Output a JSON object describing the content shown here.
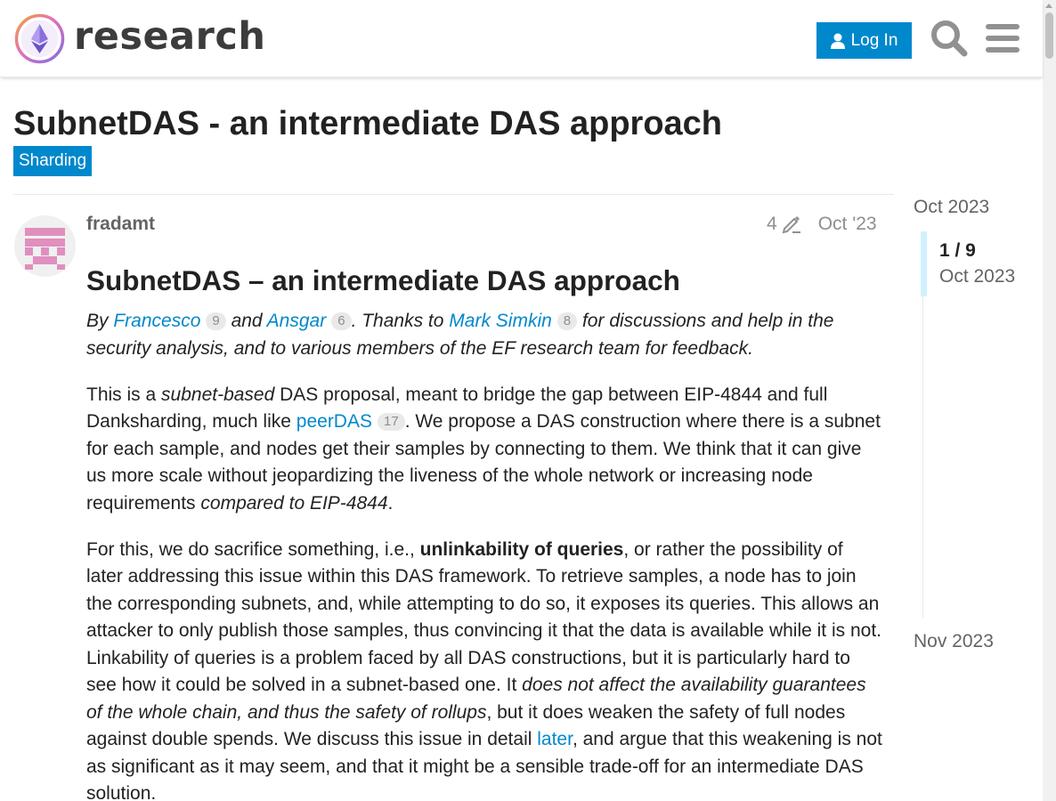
{
  "header": {
    "logo_text": "research",
    "login_label": "Log In"
  },
  "topic": {
    "title": "SubnetDAS - an intermediate DAS approach",
    "category": "Sharding"
  },
  "post": {
    "username": "fradamt",
    "edit_count": "4",
    "date": "Oct '23",
    "heading": "SubnetDAS – an intermediate DAS approach",
    "credits": {
      "by": "By ",
      "author1": "Francesco",
      "author1_count": "9",
      "and": " and ",
      "author2": "Ansgar",
      "author2_count": "6",
      "thanks": ". Thanks to ",
      "thanked": "Mark Simkin",
      "thanked_count": "8",
      "rest": " for discussions and help in the security analysis, and to various members of the EF research team for feedback."
    },
    "para1": {
      "t1": "This is a ",
      "em1": "subnet-based",
      "t2": " DAS proposal, meant to bridge the gap between EIP-4844 and full Danksharding, much like ",
      "link": "peerDAS",
      "link_count": "17",
      "t3": ". We propose a DAS construction where there is a subnet for each sample, and nodes get their samples by connecting to them. We think that it can give us more scale without jeopardizing the liveness of the whole network or increasing node requirements ",
      "em2": "compared to EIP-4844",
      "t4": "."
    },
    "para2": {
      "t1": "For this, we do sacrifice something, i.e., ",
      "strong": "unlinkability of queries",
      "t2": ", or rather the possibility of later addressing this issue within this DAS framework. To retrieve samples, a node has to join the corresponding subnets, and, while attempting to do so, it exposes its queries. This allows an attacker to only publish those samples, thus convincing it that the data is available while it is not. Linkability of queries is a problem faced by all DAS constructions, but it is particularly hard to see how it could be solved in a subnet-based one. It ",
      "em": "does not affect the availability guarantees of the whole chain, and thus the safety of rollups",
      "t3": ", but it does weaken the safety of full nodes against double spends. We discuss this issue in detail ",
      "link": "later",
      "t4": ", and argue that this weakening is not as significant as it may seem, and that it might be a sensible trade-off for an intermediate DAS solution."
    }
  },
  "timeline": {
    "start_label": "Oct 2023",
    "position": "1 / 9",
    "position_date": "Oct 2023",
    "end_label": "Nov 2023"
  },
  "colors": {
    "accent": "#0088cc",
    "avatar": "#e08fbf",
    "timeline_handle": "#d1f0ff"
  },
  "icons": {
    "user": "user-icon",
    "search": "search-icon",
    "menu": "hamburger-menu-icon",
    "pencil": "pencil-icon"
  }
}
